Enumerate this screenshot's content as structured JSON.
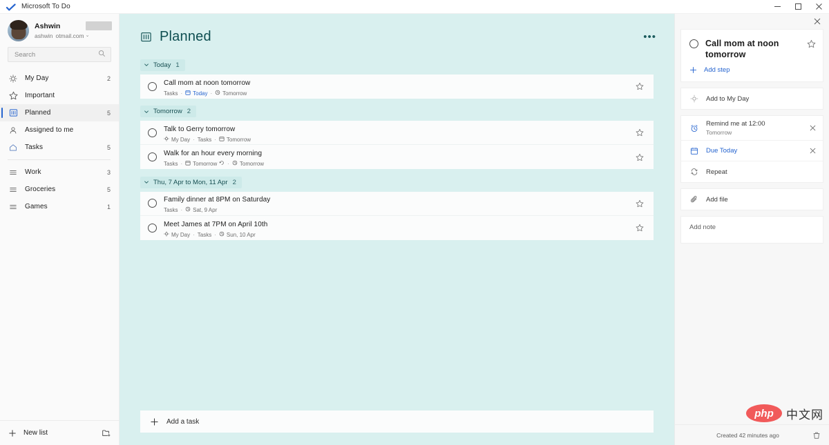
{
  "window": {
    "title": "Microsoft To Do",
    "logo_icon": "todo-check-icon",
    "minimize_icon": "minimize-icon",
    "maximize_icon": "maximize-icon",
    "close_icon": "close-icon"
  },
  "sidebar": {
    "account": {
      "name": "Ashwin",
      "email_prefix": "ashwin",
      "email_suffix": "otmail.com",
      "chevron": "⌄",
      "avatar_icon": "user-avatar"
    },
    "search": {
      "placeholder": "Search",
      "icon": "search-icon"
    },
    "smart_lists": [
      {
        "label": "My Day",
        "count": "2",
        "icon": "sun-icon",
        "selected": false
      },
      {
        "label": "Important",
        "count": "",
        "icon": "star-icon",
        "selected": false
      },
      {
        "label": "Planned",
        "count": "5",
        "icon": "planned-icon",
        "selected": true
      },
      {
        "label": "Assigned to me",
        "count": "",
        "icon": "person-icon",
        "selected": false
      },
      {
        "label": "Tasks",
        "count": "5",
        "icon": "home-icon",
        "selected": false
      }
    ],
    "custom_lists": [
      {
        "label": "Work",
        "count": "3",
        "icon": "list-icon"
      },
      {
        "label": "Groceries",
        "count": "5",
        "icon": "list-icon"
      },
      {
        "label": "Games",
        "count": "1",
        "icon": "list-icon"
      }
    ],
    "footer": {
      "new_list_label": "New list",
      "new_list_icon": "plus-icon",
      "new_group_icon": "new-group-icon"
    }
  },
  "main": {
    "title": "Planned",
    "title_icon": "planned-icon",
    "more_options": "•••",
    "add_task": {
      "label": "Add a task",
      "icon": "plus-icon"
    },
    "groups": [
      {
        "label": "Today",
        "count": "1",
        "tasks": [
          {
            "title": "Call mom at noon tomorrow",
            "meta": [
              {
                "text": "Tasks",
                "icon": "",
                "highlight": false
              },
              {
                "text": "Today",
                "icon": "calendar-icon",
                "highlight": true
              },
              {
                "text": "Tomorrow",
                "icon": "bell-icon",
                "highlight": false
              }
            ]
          }
        ]
      },
      {
        "label": "Tomorrow",
        "count": "2",
        "tasks": [
          {
            "title": "Talk to Gerry tomorrow",
            "meta": [
              {
                "text": "My Day",
                "icon": "sun-icon",
                "highlight": false
              },
              {
                "text": "Tasks",
                "icon": "",
                "highlight": false
              },
              {
                "text": "Tomorrow",
                "icon": "calendar-icon",
                "highlight": false
              }
            ]
          },
          {
            "title": "Walk for an hour every morning",
            "meta": [
              {
                "text": "Tasks",
                "icon": "",
                "highlight": false
              },
              {
                "text": "Tomorrow",
                "icon": "calendar-icon",
                "highlight": false,
                "trailing_icon": "repeat-icon"
              },
              {
                "text": "Tomorrow",
                "icon": "bell-icon",
                "highlight": false
              }
            ]
          }
        ]
      },
      {
        "label": "Thu, 7 Apr to Mon, 11 Apr",
        "count": "2",
        "tasks": [
          {
            "title": "Family dinner at 8PM on Saturday",
            "meta": [
              {
                "text": "Tasks",
                "icon": "",
                "highlight": false
              },
              {
                "text": "Sat, 9 Apr",
                "icon": "bell-icon",
                "highlight": false
              }
            ]
          },
          {
            "title": "Meet James at 7PM on April 10th",
            "meta": [
              {
                "text": "My Day",
                "icon": "sun-icon",
                "highlight": false
              },
              {
                "text": "Tasks",
                "icon": "",
                "highlight": false
              },
              {
                "text": "Sun, 10 Apr",
                "icon": "bell-icon",
                "highlight": false
              }
            ]
          }
        ]
      }
    ]
  },
  "detail": {
    "close_icon": "close-icon",
    "task_title": "Call mom at noon tomorrow",
    "star_icon": "star-icon",
    "add_step": {
      "label": "Add step",
      "icon": "plus-icon"
    },
    "add_to_my_day": {
      "label": "Add to My Day",
      "icon": "sun-icon"
    },
    "reminder": {
      "label": "Remind me at 12:00",
      "sub": "Tomorrow",
      "icon": "alarm-icon",
      "remove_icon": "close-icon"
    },
    "due": {
      "label": "Due Today",
      "icon": "calendar-icon",
      "remove_icon": "close-icon"
    },
    "repeat": {
      "label": "Repeat",
      "icon": "repeat-icon"
    },
    "add_file": {
      "label": "Add file",
      "icon": "paperclip-icon"
    },
    "add_note": {
      "placeholder": "Add note"
    },
    "created": "Created 42 minutes ago",
    "delete_icon": "trash-icon"
  },
  "watermark": {
    "badge": "php",
    "text": "中文网"
  },
  "colors": {
    "accent_blue": "#2564cf",
    "main_bg": "#d9f0ef",
    "group_chip": "#cdeae9",
    "title_teal": "#0e4e51",
    "task_bg": "#fbfcfc"
  }
}
